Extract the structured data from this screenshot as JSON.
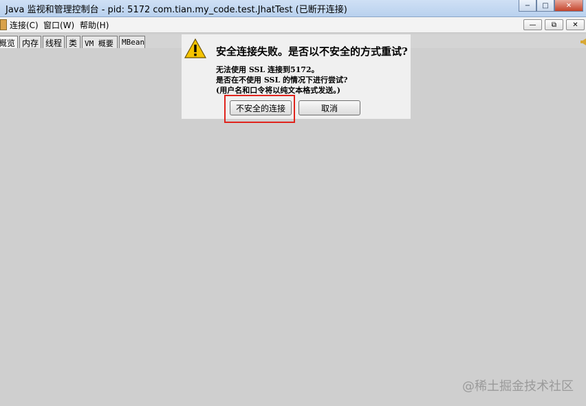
{
  "window": {
    "title": "Java 监视和管理控制台 - pid: 5172 com.tian.my_code.test.JhatTest (已断开连接)",
    "controls": [
      "−",
      "□",
      "✕"
    ]
  },
  "menubar": {
    "items": [
      "连接(C)",
      "窗口(W)",
      "帮助(H)"
    ],
    "mdi_controls": [
      "—",
      "⧉",
      "✕"
    ]
  },
  "tabs": [
    "概览",
    "内存",
    "线程",
    "类",
    "VM 概要",
    "MBean"
  ],
  "dialog": {
    "heading": "安全连接失败。是否以不安全的方式重试?",
    "lines": [
      "无法使用 SSL 连接到5172。",
      "是否在不使用 SSL 的情况下进行尝试?",
      "(用户名和口令将以纯文本格式发送。)"
    ],
    "buttons": {
      "insecure": "不安全的连接",
      "cancel": "取消"
    },
    "icon": "warning-icon"
  },
  "annotation": {
    "color": "#e0231c"
  },
  "watermark": "@稀土掘金技术社区"
}
